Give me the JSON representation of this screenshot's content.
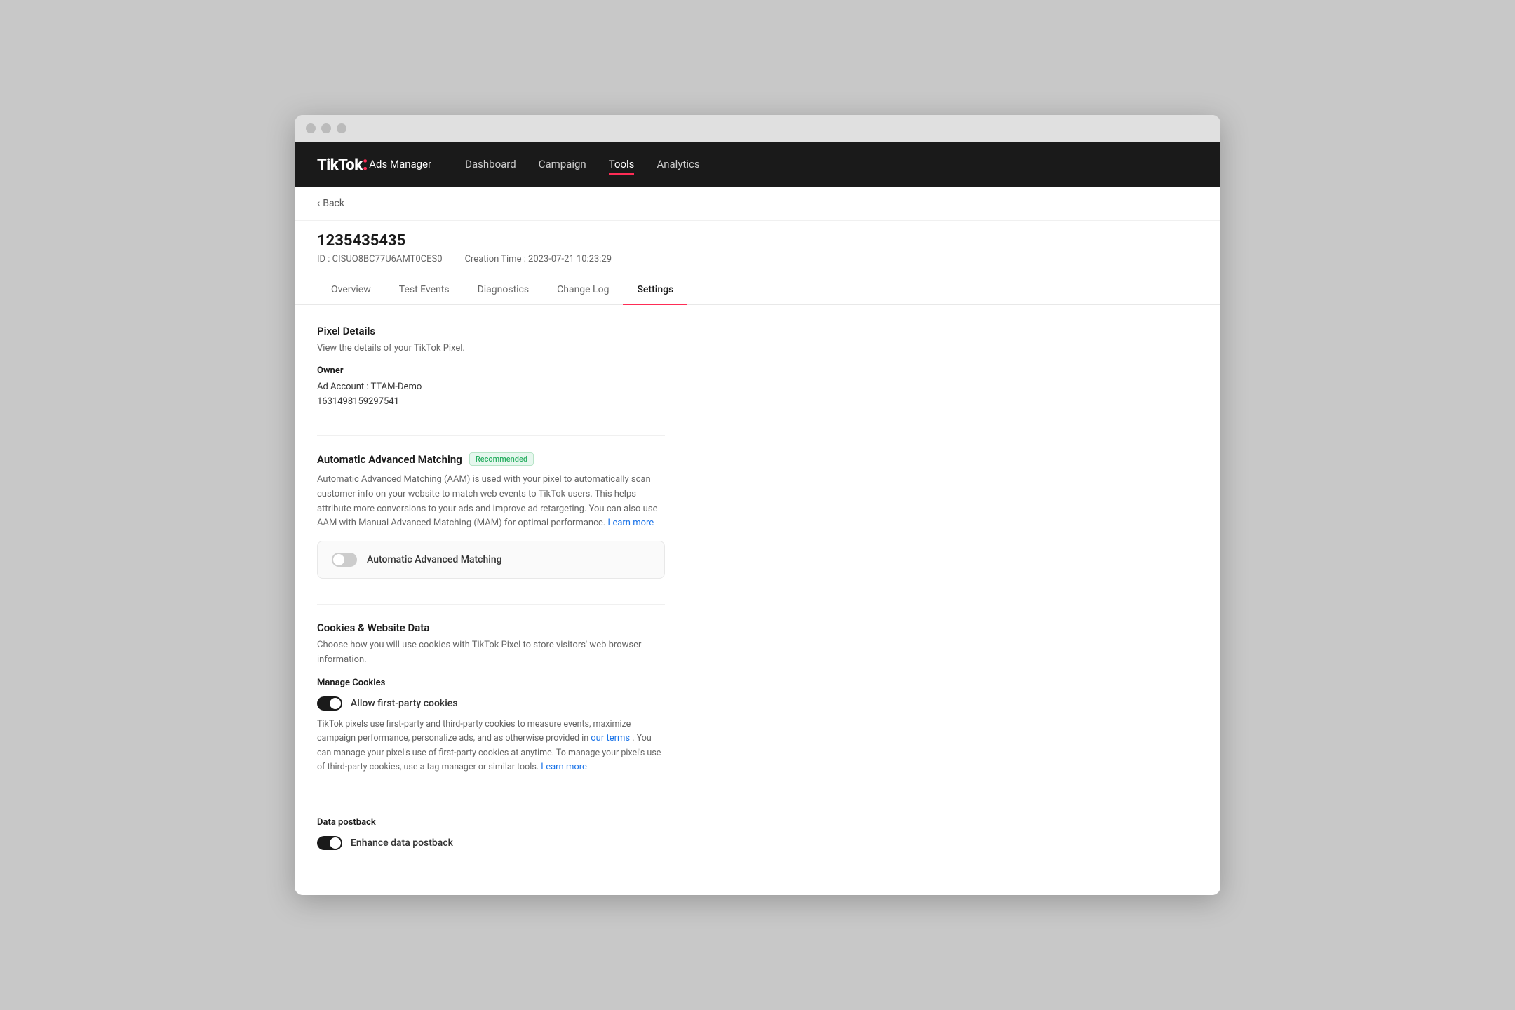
{
  "browser": {
    "dots": [
      "dot1",
      "dot2",
      "dot3"
    ]
  },
  "nav": {
    "logo": "TikTok",
    "logo_dot": ":",
    "logo_subtitle": "Ads Manager",
    "links": [
      {
        "label": "Dashboard",
        "active": false
      },
      {
        "label": "Campaign",
        "active": false
      },
      {
        "label": "Tools",
        "active": true
      },
      {
        "label": "Analytics",
        "active": false
      }
    ]
  },
  "breadcrumb": {
    "back_label": "Back"
  },
  "page": {
    "title": "1235435435",
    "id_label": "ID : CISUO8BC77U6AMT0CES0",
    "creation_time_label": "Creation Time : 2023-07-21 10:23:29"
  },
  "tabs": [
    {
      "label": "Overview",
      "active": false
    },
    {
      "label": "Test Events",
      "active": false
    },
    {
      "label": "Diagnostics",
      "active": false
    },
    {
      "label": "Change Log",
      "active": false
    },
    {
      "label": "Settings",
      "active": true
    }
  ],
  "pixel_details": {
    "title": "Pixel Details",
    "description": "View the details of your TikTok Pixel.",
    "owner_label": "Owner",
    "owner_ad_account": "Ad Account : TTAM-Demo",
    "owner_id": "1631498159297541"
  },
  "aam": {
    "title": "Automatic Advanced Matching",
    "badge": "Recommended",
    "description": "Automatic Advanced Matching (AAM) is used with your pixel to automatically scan customer info on your website to match web events to TikTok users. This helps attribute more conversions to your ads and improve ad retargeting. You can also use AAM with Manual Advanced Matching (MAM) for optimal performance.",
    "learn_more_label": "Learn more",
    "toggle_label": "Automatic Advanced Matching",
    "toggle_on": false
  },
  "cookies": {
    "title": "Cookies & Website Data",
    "description": "Choose how you will use cookies with TikTok Pixel to store visitors' web browser information.",
    "manage_cookies_label": "Manage Cookies",
    "allow_first_party_label": "Allow first-party cookies",
    "allow_first_party_on": true,
    "first_party_desc_part1": "TikTok pixels use first-party and third-party cookies to measure events, maximize campaign performance, personalize ads, and as otherwise provided in",
    "first_party_link": "our terms",
    "first_party_desc_part2": ". You can manage your pixel's use of first-party cookies at anytime. To manage your pixel's use of third-party cookies, use a tag manager or similar tools.",
    "first_party_learn_more": "Learn more"
  },
  "data_postback": {
    "title": "Data postback",
    "enhance_label": "Enhance data postback",
    "enhance_on": true
  }
}
